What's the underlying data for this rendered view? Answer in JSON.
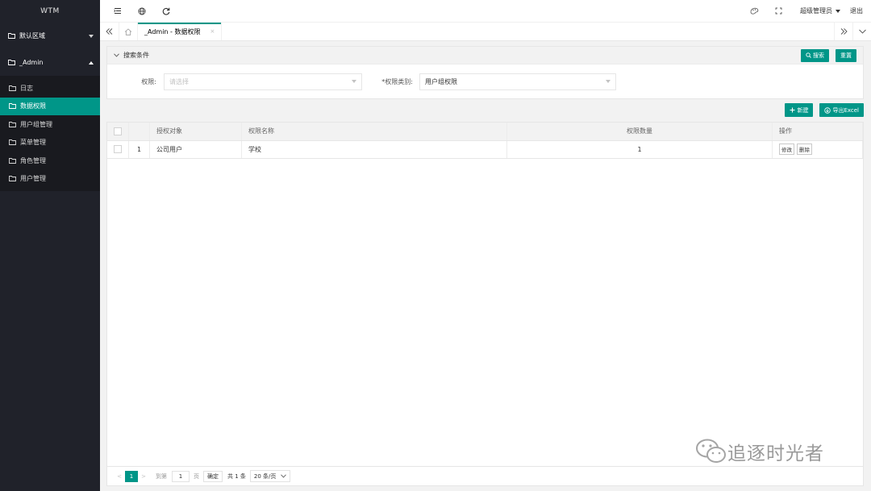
{
  "app": {
    "logo": "WTM"
  },
  "sidebar": {
    "groups": [
      {
        "label": "默认区域",
        "expanded": false
      },
      {
        "label": "_Admin",
        "expanded": true
      }
    ],
    "items": [
      {
        "label": "日志",
        "active": false
      },
      {
        "label": "数据权限",
        "active": true
      },
      {
        "label": "用户组管理",
        "active": false
      },
      {
        "label": "菜单管理",
        "active": false
      },
      {
        "label": "角色管理",
        "active": false
      },
      {
        "label": "用户管理",
        "active": false
      }
    ]
  },
  "header": {
    "icons": [
      "menu-icon",
      "globe-icon",
      "refresh-icon"
    ],
    "right_icons": [
      "theme-icon",
      "fullscreen-icon"
    ],
    "user": "超级管理员",
    "logout": "退出"
  },
  "tabs": {
    "items": [
      {
        "label": "_Admin - 数据权限",
        "close": "×"
      }
    ]
  },
  "search": {
    "title": "搜索条件",
    "search_button": "搜索",
    "reset_button": "重置",
    "fields": [
      {
        "label": "权限:",
        "placeholder": "请选择",
        "value": ""
      },
      {
        "label": "*权限类别:",
        "placeholder": "",
        "value": "用户组权限"
      }
    ]
  },
  "toolbar": {
    "create_button": "新建",
    "export_button": "导出Excel"
  },
  "table": {
    "columns": [
      "",
      "",
      "授权对象",
      "权限名称",
      "权限数量",
      "操作"
    ],
    "rows": [
      {
        "index": "1",
        "target": "公司用户",
        "name": "学校",
        "count": "1",
        "actions": [
          "修改",
          "删除"
        ]
      }
    ]
  },
  "pager": {
    "prev": "<",
    "current": "1",
    "next": ">",
    "goto_label": "到第",
    "goto_value": "1",
    "page_unit": "页",
    "confirm": "确定",
    "total": "共 1 条",
    "page_size": "20 条/页"
  },
  "watermark": {
    "text": "追逐时光者"
  },
  "colors": {
    "accent": "#009688",
    "sidebar": "#20222a",
    "sidebar_sub": "#191a1f"
  }
}
